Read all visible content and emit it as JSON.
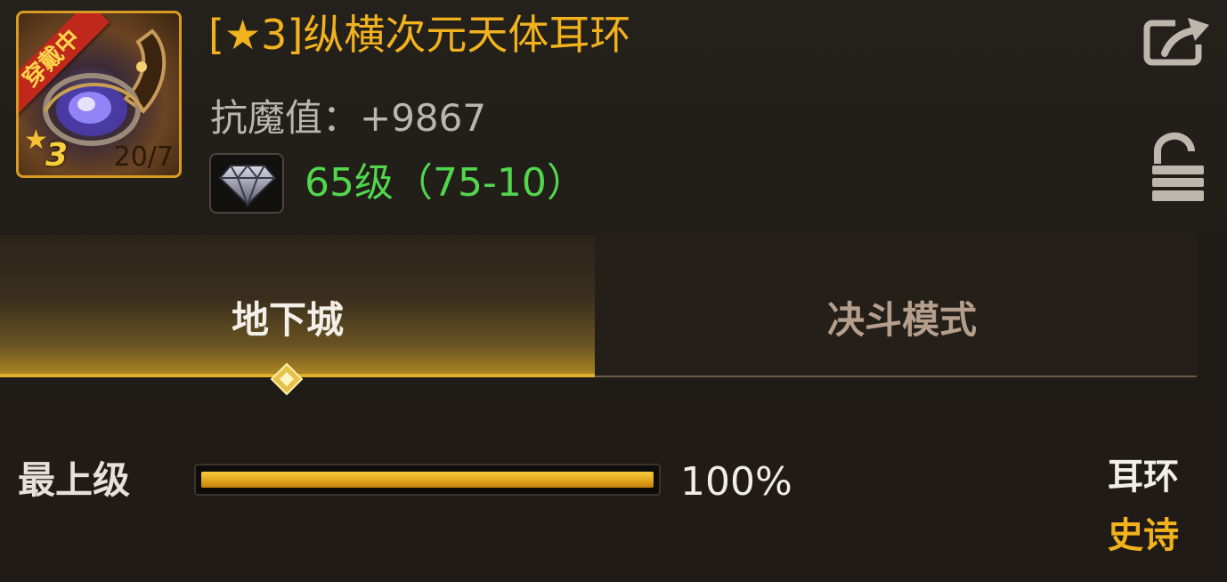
{
  "item": {
    "title": "[★3]纵横次元天体耳环",
    "equipped_badge": "穿戴中",
    "star_glyph": "★",
    "star_level": "3",
    "count": "20/7",
    "stat": "抗魔值：+9867",
    "level_range": "65级（75-10）",
    "gem_icon": "diamond-icon"
  },
  "actions": {
    "share_icon": "share-icon",
    "lock_icon": "unlocked-lock-icon"
  },
  "tabs": [
    {
      "label": "地下城",
      "active": true
    },
    {
      "label": "决斗模式",
      "active": false
    }
  ],
  "progress": {
    "label": "最上级",
    "percent_text": "100%",
    "value": 1.0,
    "slot_type": "耳环",
    "rarity": "史诗"
  },
  "colors": {
    "title_gold": "#f1b21e",
    "level_green": "#52d64e",
    "bar_gold": "#e2a01a",
    "rarity_epic": "#f1b21e"
  }
}
